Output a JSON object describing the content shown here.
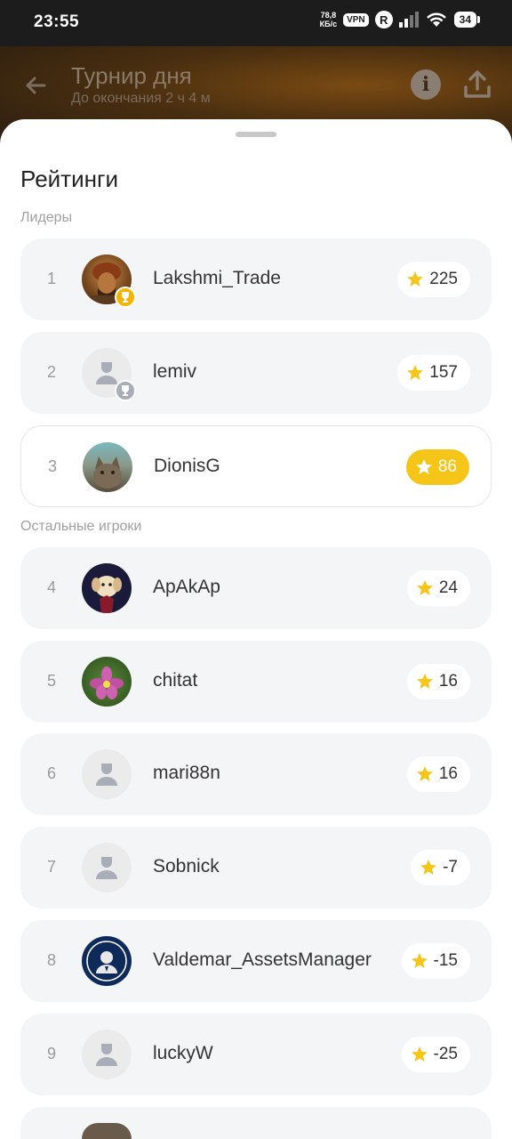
{
  "status_bar": {
    "time": "23:55",
    "net_speed_value": "78,8",
    "net_speed_unit": "КБ/с",
    "vpn": "VPN",
    "r_badge": "R",
    "battery": "34"
  },
  "header": {
    "title": "Турнир дня",
    "subtitle": "До окончания 2 ч 4 м"
  },
  "sheet": {
    "title": "Рейтинги",
    "leaders_label": "Лидеры",
    "others_label": "Остальные игроки"
  },
  "colors": {
    "accent_gold": "#f5c518",
    "row_bg": "#f4f5f6"
  },
  "leaders": [
    {
      "rank": "1",
      "name": "Lakshmi_Trade",
      "score": "225",
      "avatar": "photo-man-turban",
      "badge": "gold-trophy"
    },
    {
      "rank": "2",
      "name": "lemiv",
      "score": "157",
      "avatar": "default-user",
      "badge": "silver-trophy"
    },
    {
      "rank": "3",
      "name": "DionisG",
      "score": "86",
      "avatar": "photo-cat",
      "highlighted": true
    }
  ],
  "players": [
    {
      "rank": "4",
      "name": "ApAkAp",
      "score": "24",
      "avatar": "photo-dog"
    },
    {
      "rank": "5",
      "name": "chitat",
      "score": "16",
      "avatar": "photo-flower"
    },
    {
      "rank": "6",
      "name": "mari88n",
      "score": "16",
      "avatar": "default-user"
    },
    {
      "rank": "7",
      "name": "Sobnick",
      "score": "-7",
      "avatar": "default-user"
    },
    {
      "rank": "8",
      "name": "Valdemar_AssetsManager",
      "score": "-15",
      "avatar": "logo-assets"
    },
    {
      "rank": "9",
      "name": "luckyW",
      "score": "-25",
      "avatar": "default-user"
    }
  ]
}
